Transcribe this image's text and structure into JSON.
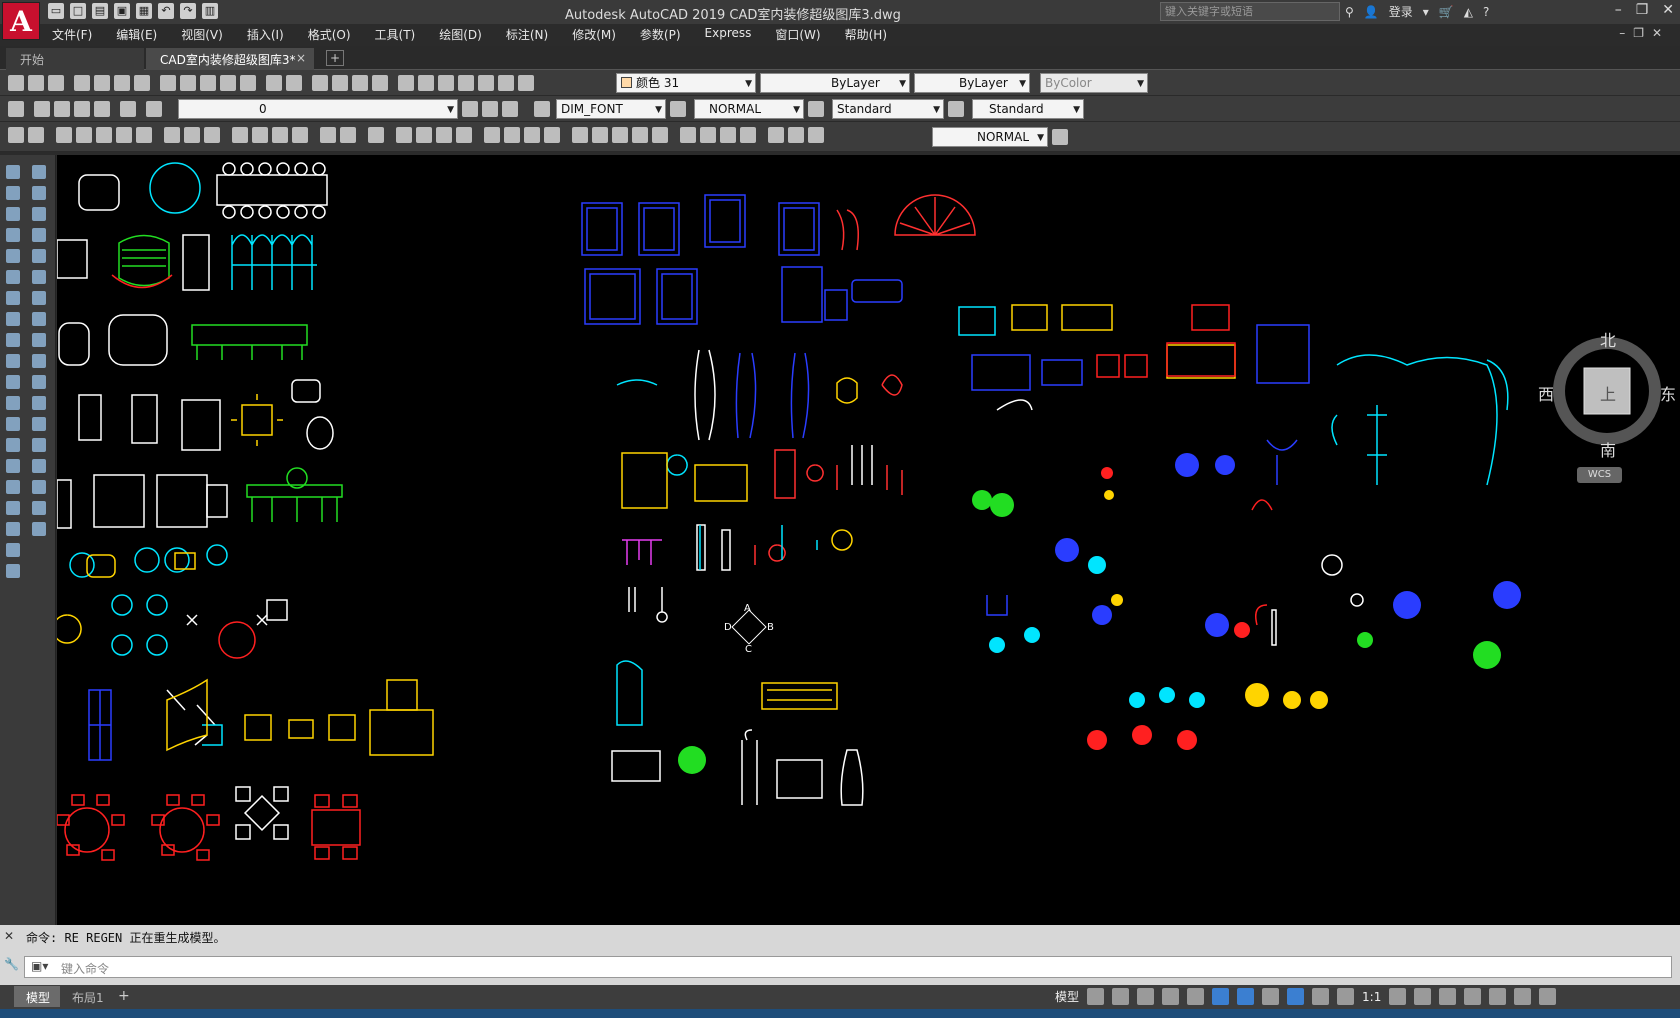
{
  "app": {
    "logo": "A",
    "title": "Autodesk AutoCAD 2019    CAD室内装修超级图库3.dwg",
    "search_placeholder": "键入关键字或短语",
    "login": "登录"
  },
  "menu": [
    "文件(F)",
    "编辑(E)",
    "视图(V)",
    "插入(I)",
    "格式(O)",
    "工具(T)",
    "绘图(D)",
    "标注(N)",
    "修改(M)",
    "参数(P)",
    "Express",
    "窗口(W)",
    "帮助(H)"
  ],
  "tabs": {
    "start": "开始",
    "doc": "CAD室内装修超级图库3*",
    "close": "×",
    "plus": "+"
  },
  "toolbar": {
    "color": "颜色 31",
    "linetype": "ByLayer",
    "lineweight": "ByLayer",
    "plotstyle": "ByColor",
    "layer": "0",
    "text_style": "DIM_FONT",
    "dim_style": "NORMAL",
    "table_style": "Standard",
    "mleader_style": "Standard",
    "dim_style2": "NORMAL"
  },
  "viewcube": {
    "north": "北",
    "south": "南",
    "east": "东",
    "west": "西",
    "top": "上",
    "wcs": "WCS"
  },
  "command": {
    "history": "命令: RE REGEN 正在重生成模型。",
    "placeholder": "键入命令"
  },
  "layout_tabs": {
    "model": "模型",
    "layout1": "布局1",
    "plus": "+"
  },
  "status": {
    "model": "模型",
    "scale": "1:1"
  },
  "canvas_labels": {
    "A": "A",
    "B": "B",
    "C": "C",
    "D": "D"
  }
}
